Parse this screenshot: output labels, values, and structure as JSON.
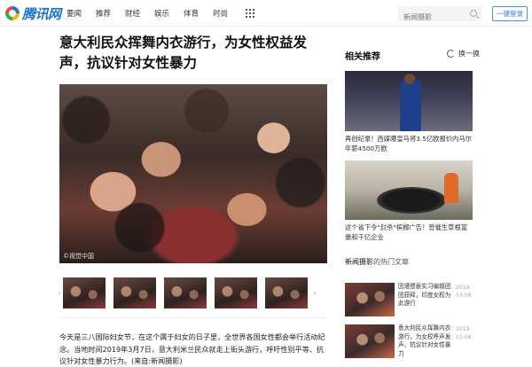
{
  "logo": {
    "text": "腾讯网"
  },
  "nav": {
    "items": [
      "要闻",
      "推荐",
      "财经",
      "娱乐",
      "体育",
      "时尚"
    ],
    "more_icon": "grid-icon"
  },
  "search": {
    "placeholder": "新闻摄影"
  },
  "reading_button": "一键登录",
  "article": {
    "headline": "意大利民众挥舞内衣游行，为女性权益发声，抗议针对女性暴力",
    "photo_watermark": "©视觉中国",
    "body": "今天是三八国际妇女节，在这个属于妇女的日子里，全世界各国女性都会举行活动纪念。当地时间2019年3月7日，意大利米兰民众就走上街头游行，呼吁性别平等、抗议针对女性暴力行为。(来自:新闻摄影)"
  },
  "sidebar": {
    "related_title": "相关推荐",
    "refresh_label": "换一换",
    "related": [
      {
        "caption": "再创纪录！西媒曝皇马将3.5亿欧报价内马尔 年薪4500万欧"
      },
      {
        "caption": "这个省下令\"封杀\"槟榔广告！曾催生草根富豪和千亿企业"
      }
    ],
    "section_title_bold": "新闻摄影",
    "section_title_rest": "的热门文章",
    "hot_news": [
      {
        "title": "因遭猥亵实习编辑团团获释，印度女权为此游行",
        "date": "2019-03-08"
      },
      {
        "title": "意大利民众挥舞内衣游行，为女权呼声发声，抗议针对女性暴力",
        "date": "2019-03-08"
      }
    ]
  },
  "colors": {
    "brand_blue": "#1f6fd6",
    "button_border": "#4a90e2",
    "text": "#222222"
  }
}
